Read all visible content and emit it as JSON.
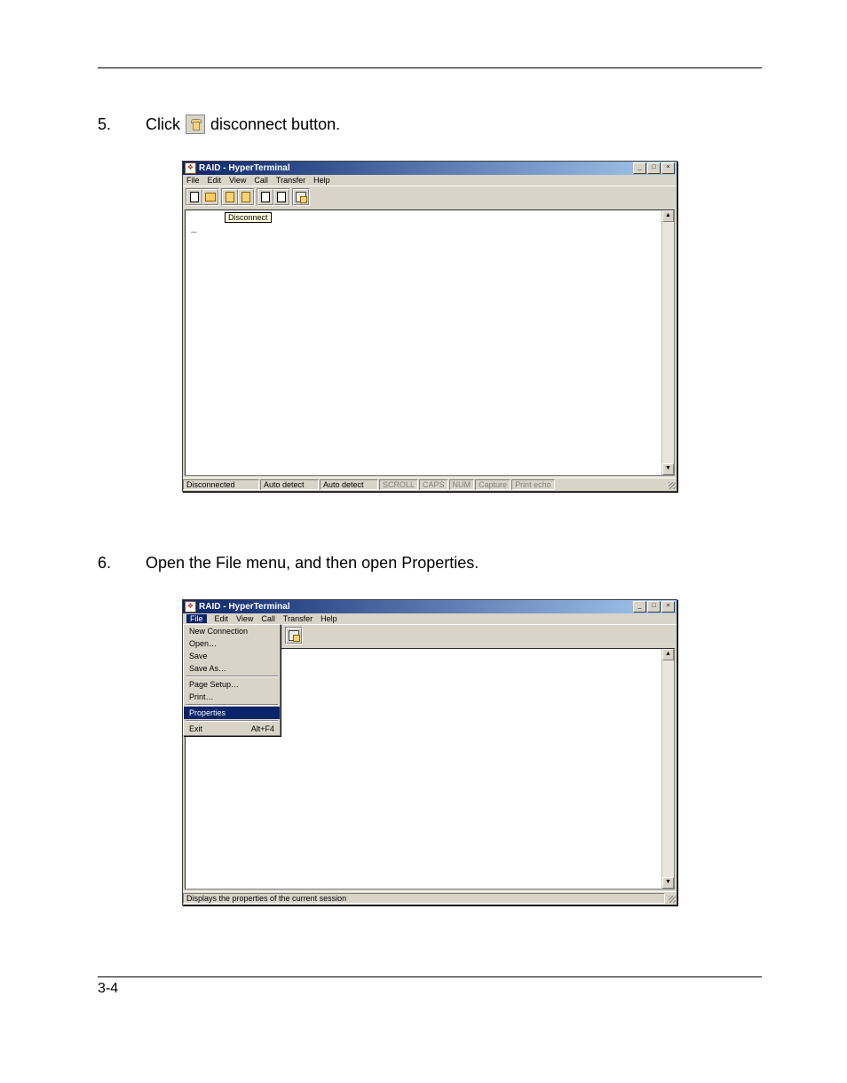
{
  "step5": {
    "num": "5.",
    "pre": "Click",
    "iconName": "disconnect-icon",
    "post": "disconnect button."
  },
  "step6": {
    "num": "6.",
    "text": "Open the File menu, and then open Properties."
  },
  "window": {
    "title": "RAID - HyperTerminal",
    "menus": [
      "File",
      "Edit",
      "View",
      "Call",
      "Transfer",
      "Help"
    ],
    "tooltip": "Disconnect",
    "termContent": "_"
  },
  "status": {
    "conn": "Disconnected",
    "det1": "Auto detect",
    "det2": "Auto detect",
    "scroll": "SCROLL",
    "caps": "CAPS",
    "num": "NUM",
    "capture": "Capture",
    "echo": "Print echo"
  },
  "filemenu": {
    "newconn": "New Connection",
    "open": "Open…",
    "save": "Save",
    "saveas": "Save As…",
    "pagesetup": "Page Setup…",
    "print": "Print…",
    "properties": "Properties",
    "exit": "Exit",
    "exitKey": "Alt+F4"
  },
  "status2": "Displays the properties of the current session",
  "footer": "3-4"
}
